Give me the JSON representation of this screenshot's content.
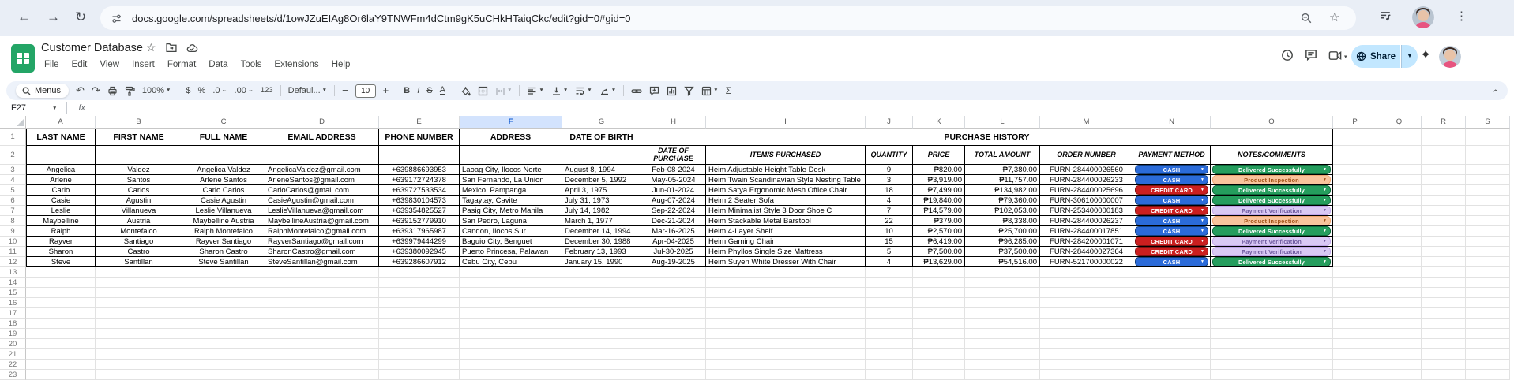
{
  "browser": {
    "url": "docs.google.com/spreadsheets/d/1owJZuEIAg8Or6laY9TNWFm4dCtm9gK5uCHkHTaiqCkc/edit?gid=0#gid=0"
  },
  "header": {
    "title": "Customer Database",
    "menus": [
      "File",
      "Edit",
      "View",
      "Insert",
      "Format",
      "Data",
      "Tools",
      "Extensions",
      "Help"
    ],
    "share_label": "Share"
  },
  "toolbar": {
    "menus_label": "Menus",
    "zoom": "100%",
    "font_name": "Defaul...",
    "font_size": "10",
    "glyphs": {
      "undo": "↶",
      "redo": "↷",
      "dollar": "$",
      "percent": "%",
      "dec_dec": ".0",
      "dec_inc": ".00",
      "num_fmt": "123",
      "minus": "−",
      "plus": "+",
      "bold": "B",
      "italic": "I",
      "strike": "S",
      "text_color": "A",
      "sum": "Σ"
    }
  },
  "formula_bar": {
    "cell_ref": "F27",
    "fx_label": "fx",
    "formula": ""
  },
  "grid": {
    "column_letters": [
      "A",
      "B",
      "C",
      "D",
      "E",
      "F",
      "G",
      "H",
      "I",
      "J",
      "K",
      "L",
      "M",
      "N",
      "O",
      "P",
      "Q",
      "R",
      "S"
    ],
    "selected_column": "F",
    "row_numbers": [
      1,
      2,
      3,
      4,
      5,
      6,
      7,
      8,
      9,
      10,
      11,
      12,
      13,
      14,
      15,
      16,
      17,
      18,
      19,
      20,
      21,
      22,
      23
    ],
    "headers_main": [
      "LAST NAME",
      "FIRST NAME",
      "FULL NAME",
      "EMAIL ADDRESS",
      "PHONE NUMBER",
      "ADDRESS",
      "DATE OF BIRTH"
    ],
    "purchase_history_label": "PURCHASE HISTORY",
    "headers_sub": [
      "DATE OF PURCHASE",
      "ITEM/S PURCHASED",
      "QUANTITY",
      "PRICE",
      "TOTAL AMOUNT",
      "ORDER NUMBER",
      "PAYMENT METHOD",
      "NOTES/COMMENTS"
    ],
    "rows": [
      {
        "last_name": "Angelica",
        "first_name": "Valdez",
        "full_name": "Angelica Valdez",
        "email": "AngelicaValdez@gmail.com",
        "phone": "+639886693953",
        "address": "Laoag City, Ilocos Norte",
        "birth_date": "August 8, 1994",
        "purchase_date": "Feb-08-2024",
        "item": "Heim Adjustable Height Table Desk",
        "quantity": "9",
        "price": "₱820.00",
        "total": "₱7,380.00",
        "order_number": "FURN-284400026560",
        "payment": "CASH",
        "payment_style": "cash",
        "notes": "Delivered Successfully",
        "notes_style": "delivered"
      },
      {
        "last_name": "Arlene",
        "first_name": "Santos",
        "full_name": "Arlene Santos",
        "email": "ArleneSantos@gmail.com",
        "phone": "+639172724378",
        "address": "San Fernando, La Union",
        "birth_date": "December 5, 1992",
        "purchase_date": "May-05-2024",
        "item": "Heim Twain Scandinavian Style Nesting Table",
        "quantity": "3",
        "price": "₱3,919.00",
        "total": "₱11,757.00",
        "order_number": "FURN-284400026233",
        "payment": "CASH",
        "payment_style": "cash",
        "notes": "Product Inspection",
        "notes_style": "inspection"
      },
      {
        "last_name": "Carlo",
        "first_name": "Carlos",
        "full_name": "Carlo Carlos",
        "email": "CarloCarlos@gmail.com",
        "phone": "+639727533534",
        "address": "Mexico, Pampanga",
        "birth_date": "April 3, 1975",
        "purchase_date": "Jun-01-2024",
        "item": "Heim Satya Ergonomic Mesh Office Chair",
        "quantity": "18",
        "price": "₱7,499.00",
        "total": "₱134,982.00",
        "order_number": "FURN-284400025696",
        "payment": "CREDIT CARD",
        "payment_style": "credit",
        "notes": "Delivered Successfully",
        "notes_style": "delivered"
      },
      {
        "last_name": "Casie",
        "first_name": "Agustin",
        "full_name": "Casie Agustin",
        "email": "CasieAgustin@gmail.com",
        "phone": "+639830104573",
        "address": "Tagaytay, Cavite",
        "birth_date": "July 31, 1973",
        "purchase_date": "Aug-07-2024",
        "item": "Heim 2 Seater Sofa",
        "quantity": "4",
        "price": "₱19,840.00",
        "total": "₱79,360.00",
        "order_number": "FURN-306100000007",
        "payment": "CASH",
        "payment_style": "cash",
        "notes": "Delivered Successfully",
        "notes_style": "delivered"
      },
      {
        "last_name": "Leslie",
        "first_name": "Villanueva",
        "full_name": "Leslie Villanueva",
        "email": "LeslieVillanueva@gmail.com",
        "phone": "+639354825527",
        "address": "Pasig City, Metro Manila",
        "birth_date": "July 14, 1982",
        "purchase_date": "Sep-22-2024",
        "item": "Heim Minimalist Style 3 Door Shoe C",
        "quantity": "7",
        "price": "₱14,579.00",
        "total": "₱102,053.00",
        "order_number": "FURN-253400000183",
        "payment": "CREDIT CARD",
        "payment_style": "credit",
        "notes": "Payment Verification",
        "notes_style": "verification"
      },
      {
        "last_name": "Maybelline",
        "first_name": "Austria",
        "full_name": "Maybelline Austria",
        "email": "MaybellineAustria@gmail.com",
        "phone": "+639152779910",
        "address": "San Pedro, Laguna",
        "birth_date": "March 1, 1977",
        "purchase_date": "Dec-21-2024",
        "item": "Heim Stackable Metal Barstool",
        "quantity": "22",
        "price": "₱379.00",
        "total": "₱8,338.00",
        "order_number": "FURN-284400026237",
        "payment": "CASH",
        "payment_style": "cash",
        "notes": "Product Inspection",
        "notes_style": "inspection"
      },
      {
        "last_name": "Ralph",
        "first_name": "Montefalco",
        "full_name": "Ralph Montefalco",
        "email": "RalphMontefalco@gmail.com",
        "phone": "+639317965987",
        "address": "Candon, Ilocos Sur",
        "birth_date": "December 14, 1994",
        "purchase_date": "Mar-16-2025",
        "item": "Heim 4-Layer Shelf",
        "quantity": "10",
        "price": "₱2,570.00",
        "total": "₱25,700.00",
        "order_number": "FURN-284400017851",
        "payment": "CASH",
        "payment_style": "cash",
        "notes": "Delivered Successfully",
        "notes_style": "delivered"
      },
      {
        "last_name": "Rayver",
        "first_name": "Santiago",
        "full_name": "Rayver Santiago",
        "email": "RayverSantiago@gmail.com",
        "phone": "+639979444299",
        "address": "Baguio City, Benguet",
        "birth_date": "December 30, 1988",
        "purchase_date": "Apr-04-2025",
        "item": "Heim Gaming Chair",
        "quantity": "15",
        "price": "₱6,419.00",
        "total": "₱96,285.00",
        "order_number": "FURN-284200001071",
        "payment": "CREDIT CARD",
        "payment_style": "credit",
        "notes": "Payment Verification",
        "notes_style": "verification"
      },
      {
        "last_name": "Sharon",
        "first_name": "Castro",
        "full_name": "Sharon Castro",
        "email": "SharonCastro@gmail.com",
        "phone": "+639380092945",
        "address": "Puerto Princesa, Palawan",
        "birth_date": "February 13, 1993",
        "purchase_date": "Jul-30-2025",
        "item": "Heim Phyllos Single Size Mattress",
        "quantity": "5",
        "price": "₱7,500.00",
        "total": "₱37,500.00",
        "order_number": "FURN-284400027364",
        "payment": "CREDIT CARD",
        "payment_style": "credit",
        "notes": "Payment Verification",
        "notes_style": "verification"
      },
      {
        "last_name": "Steve",
        "first_name": "Santillan",
        "full_name": "Steve Santillan",
        "email": "SteveSantillan@gmail.com",
        "phone": "+639286607912",
        "address": "Cebu City, Cebu",
        "birth_date": "January 15, 1990",
        "purchase_date": "Aug-19-2025",
        "item": "Heim Suyen White Dresser With Chair",
        "quantity": "4",
        "price": "₱13,629.00",
        "total": "₱54,516.00",
        "order_number": "FURN-521700000022",
        "payment": "CASH",
        "payment_style": "cash",
        "notes": "Delivered Successfully",
        "notes_style": "delivered"
      }
    ]
  },
  "colors": {
    "accent_blue": "#0b57d0",
    "selected_header_bg": "#d3e3fd",
    "share_pill_bg": "#c2e7ff",
    "toolbar_bg": "#edf2fa",
    "chrome_bg": "#e9eef6",
    "sheets_green": "#23a566",
    "chips": {
      "cash": {
        "bg": "#2b6bd9",
        "border": "#123f80",
        "text": "#ffffff"
      },
      "credit": {
        "bg": "#cb1f1f",
        "border": "#7d1212",
        "text": "#ffffff"
      },
      "delivered": {
        "bg": "#259d5d",
        "border": "#0f6b3c",
        "text": "#ffffff"
      },
      "inspection": {
        "bg": "#f9c49d",
        "border": "#f0a570",
        "text": "#a35418"
      },
      "verification": {
        "bg": "#d9c9f4",
        "border": "#c0a5ea",
        "text": "#6f5ba0"
      }
    }
  }
}
